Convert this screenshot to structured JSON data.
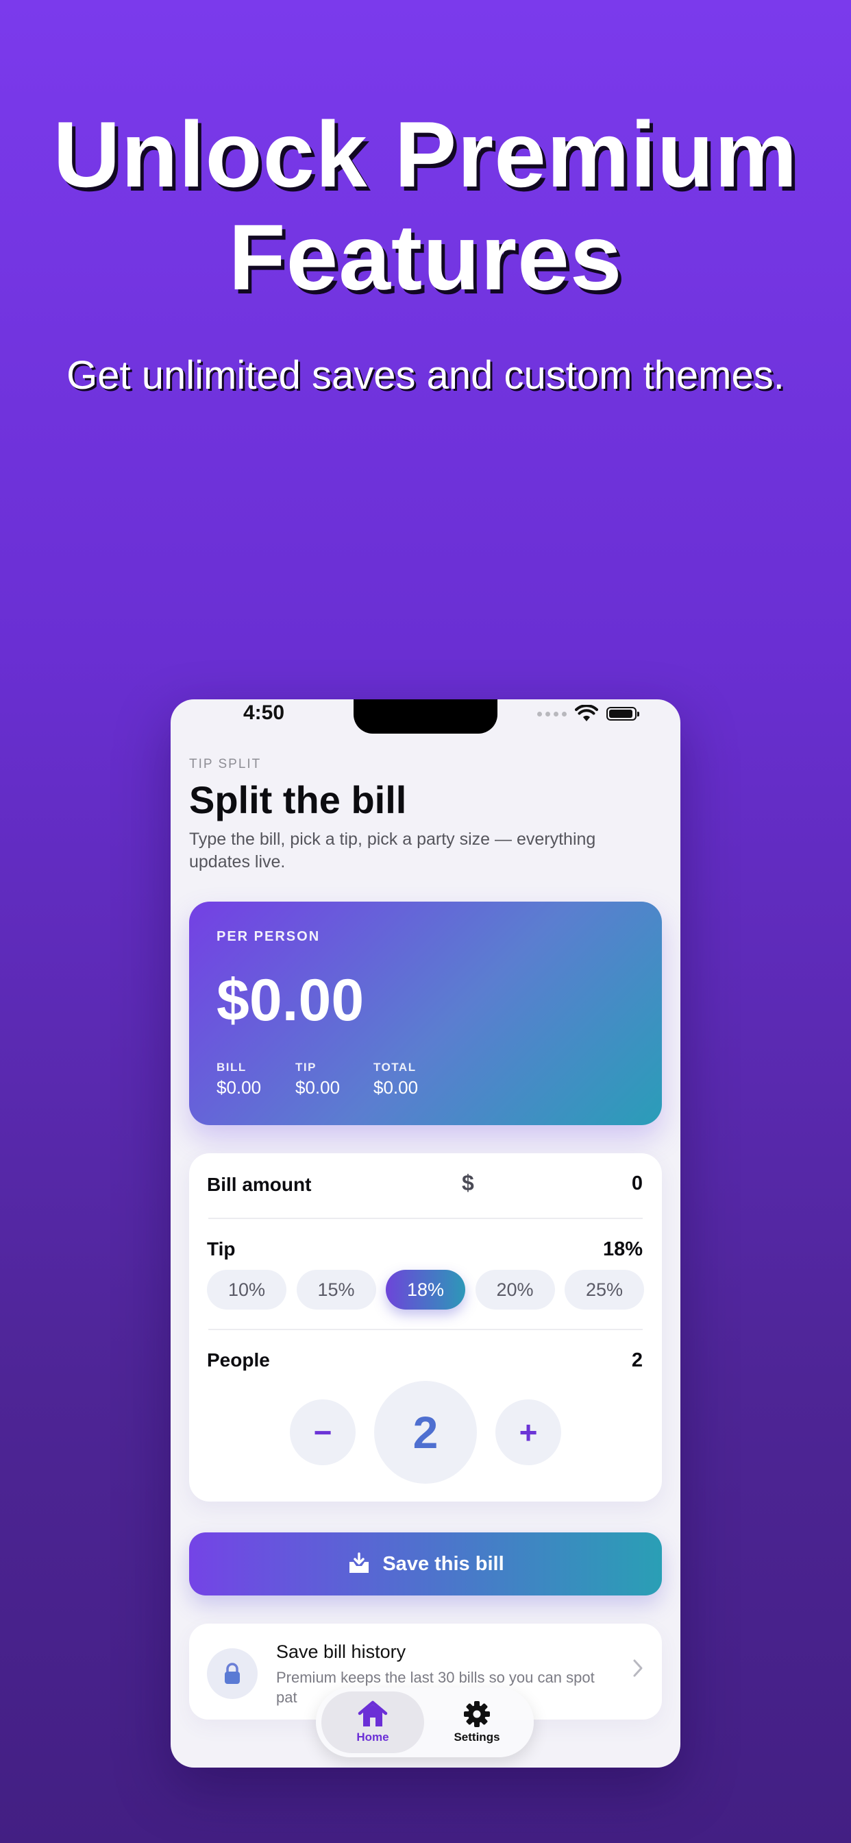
{
  "marketing": {
    "headline_line1": "Unlock Premium",
    "headline_line2": "Features",
    "subhead": "Get unlimited saves and custom themes."
  },
  "status_bar": {
    "time": "4:50"
  },
  "header": {
    "eyebrow": "TIP SPLIT",
    "title": "Split the bill",
    "description": "Type the bill, pick a tip, pick a party size — everything updates live."
  },
  "summary": {
    "label": "PER PERSON",
    "per_person": "$0.00",
    "stats": [
      {
        "label": "BILL",
        "value": "$0.00"
      },
      {
        "label": "TIP",
        "value": "$0.00"
      },
      {
        "label": "TOTAL",
        "value": "$0.00"
      }
    ]
  },
  "form": {
    "bill_label": "Bill amount",
    "currency_symbol": "$",
    "bill_value": "0",
    "tip_label": "Tip",
    "tip_value": "18%",
    "tip_options": [
      "10%",
      "15%",
      "18%",
      "20%",
      "25%"
    ],
    "selected_tip": "18%",
    "people_label": "People",
    "people_value": "2",
    "minus_symbol": "−",
    "plus_symbol": "+"
  },
  "actions": {
    "save_label": "Save this bill"
  },
  "premium_row": {
    "title": "Save bill history",
    "subtitle": "Premium keeps the last 30 bills so you can spot pat"
  },
  "tabbar": {
    "items": [
      {
        "label": "Home",
        "icon": "house-icon",
        "active": true
      },
      {
        "label": "Settings",
        "icon": "gear-icon",
        "active": false
      }
    ]
  },
  "colors": {
    "background_top": "#7b3aec",
    "background_bottom": "#431f83",
    "accent_purple": "#6b34d6",
    "accent_teal": "#2a9fb5"
  }
}
